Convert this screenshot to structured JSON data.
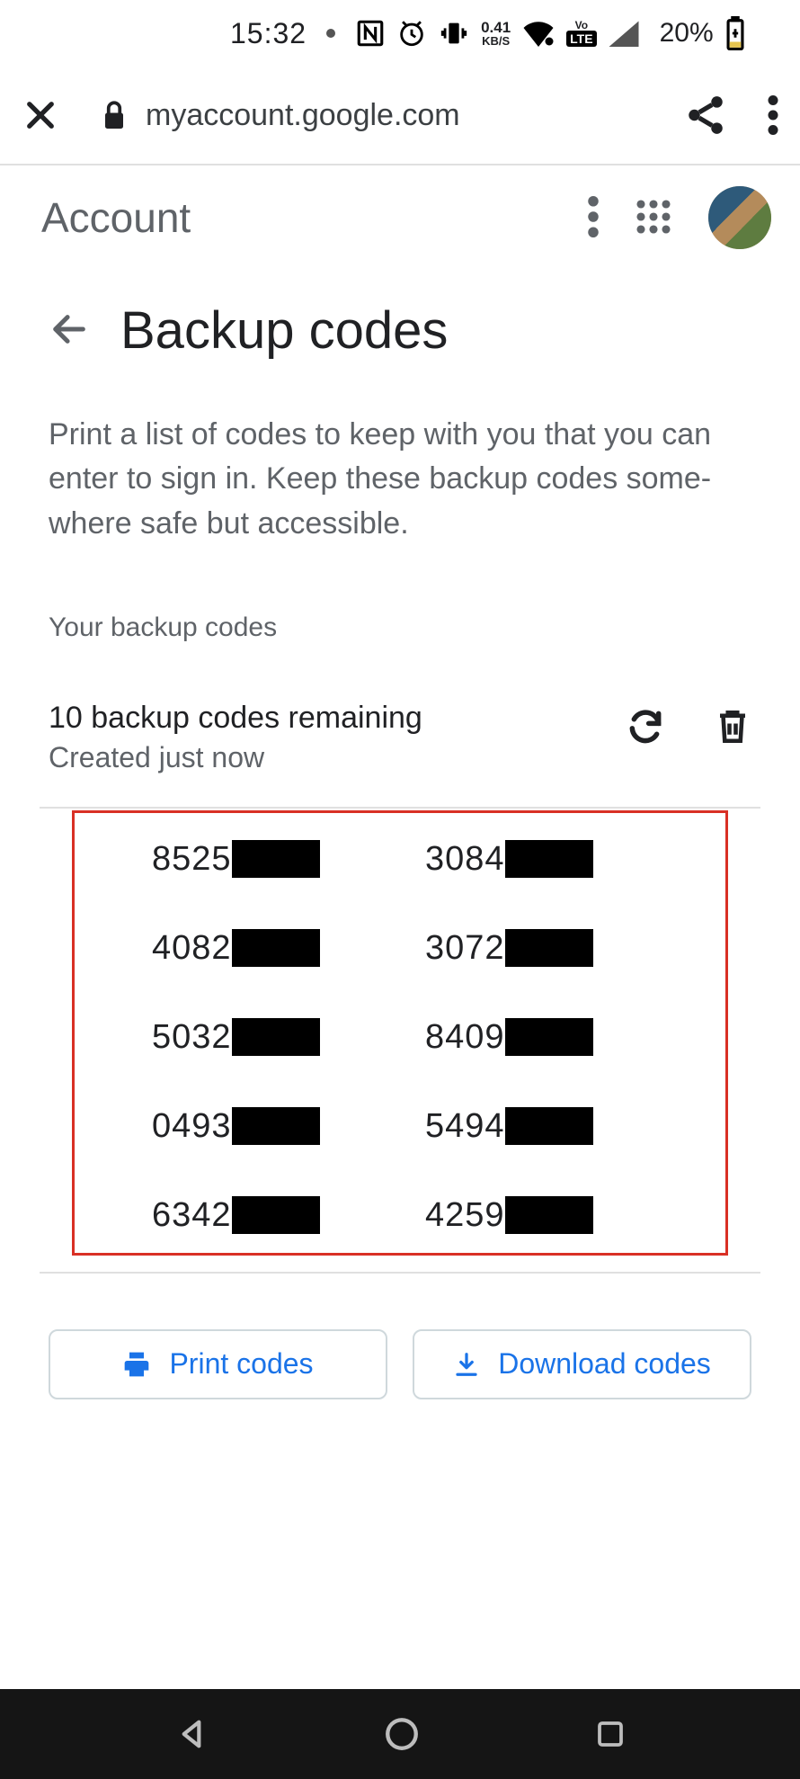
{
  "status": {
    "time": "15:32",
    "net_speed_value": "0.41",
    "net_speed_unit": "KB/S",
    "lte_label": "LTE",
    "volte_label": "Vo",
    "battery_pct": "20%"
  },
  "browser": {
    "url": "myaccount.google.com"
  },
  "account_header": {
    "title": "Account"
  },
  "page": {
    "title": "Backup codes",
    "description": "Print a list of codes to keep with you that you can enter to sign in. Keep these backup codes some‐where safe but accessible.",
    "section_label": "Your backup codes",
    "remaining": "10 backup codes remaining",
    "created": "Created just now"
  },
  "codes": {
    "col1": [
      "8525",
      "4082",
      "5032",
      "0493",
      "6342"
    ],
    "col2": [
      "3084",
      "3072",
      "8409",
      "5494",
      "4259"
    ]
  },
  "buttons": {
    "print": "Print codes",
    "download": "Download codes"
  }
}
